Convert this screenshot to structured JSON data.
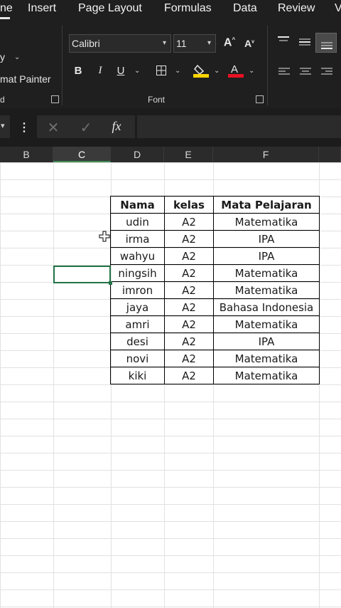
{
  "ribbon": {
    "tabs": [
      "ne",
      "Insert",
      "Page Layout",
      "Formulas",
      "Data",
      "Review",
      "V"
    ],
    "clipboard": {
      "copy_partial": "y",
      "format_painter_partial": "mat Painter",
      "group_label_partial": "d"
    },
    "font": {
      "font_name": "Calibri",
      "font_size": "11",
      "group_label": "Font"
    }
  },
  "grid": {
    "columns": [
      "B",
      "C",
      "D",
      "E",
      "F"
    ],
    "selected_column": "C",
    "table": {
      "headers": [
        "Nama",
        "kelas",
        "Mata Pelajaran"
      ],
      "rows": [
        [
          "udin",
          "A2",
          "Matematika"
        ],
        [
          "irma",
          "A2",
          "IPA"
        ],
        [
          "wahyu",
          "A2",
          "IPA"
        ],
        [
          "ningsih",
          "A2",
          "Matematika"
        ],
        [
          "imron",
          "A2",
          "Matematika"
        ],
        [
          "jaya",
          "A2",
          "Bahasa Indonesia"
        ],
        [
          "amri",
          "A2",
          "Matematika"
        ],
        [
          "desi",
          "A2",
          "IPA"
        ],
        [
          "novi",
          "A2",
          "Matematika"
        ],
        [
          "kiki",
          "A2",
          "Matematika"
        ]
      ]
    }
  },
  "colors": {
    "ribbon_bg": "#1f1f1f",
    "selection": "#217346",
    "highlight_bar": "#ffd400",
    "font_color_bar": "#e81123"
  }
}
